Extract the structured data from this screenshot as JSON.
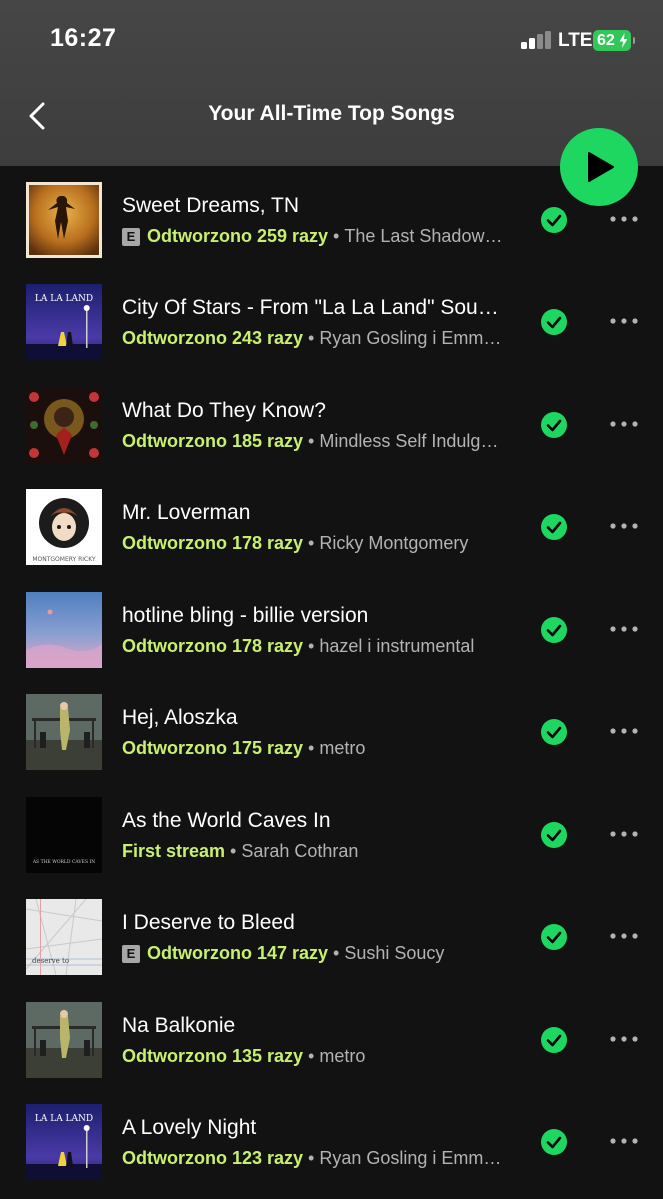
{
  "status_bar": {
    "time": "16:27",
    "network": "LTE",
    "battery": "62"
  },
  "header": {
    "title": "Your All-Time Top Songs",
    "back_icon": "chevron-left-icon",
    "play_icon": "play-icon"
  },
  "colors": {
    "accent": "#1ed760",
    "play_count": "#c8f06f",
    "background": "#121212"
  },
  "songs": [
    {
      "title": "Sweet Dreams, TN",
      "explicit": "E",
      "plays": "Odtworzono 259 razy",
      "artist": "The Last Shadow Puppets"
    },
    {
      "title": "City Of Stars - From \"La La Land\" Soundtrack",
      "explicit": "",
      "plays": "Odtworzono 243 razy",
      "artist": "Ryan Gosling i Emma Stone"
    },
    {
      "title": "What Do They Know?",
      "explicit": "",
      "plays": "Odtworzono 185 razy",
      "artist": "Mindless Self Indulgence"
    },
    {
      "title": "Mr. Loverman",
      "explicit": "",
      "plays": "Odtworzono 178 razy",
      "artist": "Ricky Montgomery"
    },
    {
      "title": "hotline bling - billie version",
      "explicit": "",
      "plays": "Odtworzono 178 razy",
      "artist": "hazel i instrumental"
    },
    {
      "title": "Hej, Aloszka",
      "explicit": "",
      "plays": "Odtworzono 175 razy",
      "artist": "metro"
    },
    {
      "title": "As the World Caves In",
      "explicit": "",
      "plays": "First stream",
      "artist": "Sarah Cothran"
    },
    {
      "title": "I Deserve to Bleed",
      "explicit": "E",
      "plays": "Odtworzono 147 razy",
      "artist": "Sushi Soucy"
    },
    {
      "title": "Na Balkonie",
      "explicit": "",
      "plays": "Odtworzono 135 razy",
      "artist": "metro"
    },
    {
      "title": "A Lovely Night",
      "explicit": "",
      "plays": "Odtworzono 123 razy",
      "artist": "Ryan Gosling i Emma Stone"
    }
  ],
  "covers": {
    "sweet_dreams": {
      "text": ""
    },
    "la_la_land": {
      "text": "LA LA LAND"
    },
    "montgomery": {
      "text": "MONTGOMERY RICKY"
    },
    "caves": {
      "text": "AS THE WORLD CAVES IN"
    },
    "bleed": {
      "text": "deserve to"
    }
  },
  "separator": "•",
  "more_icon": "more-options-icon",
  "saved_icon": "saved-check-icon"
}
